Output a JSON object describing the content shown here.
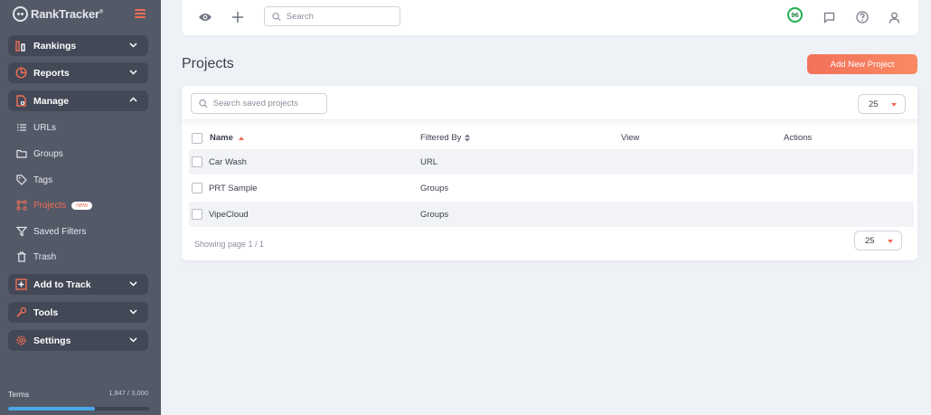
{
  "app": {
    "logo_text": "RankTracker"
  },
  "sidebar": {
    "sections": [
      {
        "label": "Rankings",
        "icon": "rankings-icon",
        "expanded": false
      },
      {
        "label": "Reports",
        "icon": "pie-chart-icon",
        "expanded": false
      },
      {
        "label": "Manage",
        "icon": "file-icon",
        "expanded": true
      },
      {
        "label": "Add to Track",
        "icon": "plus-box-icon",
        "expanded": false
      },
      {
        "label": "Tools",
        "icon": "wrench-icon",
        "expanded": false
      },
      {
        "label": "Settings",
        "icon": "gear-icon",
        "expanded": false
      }
    ],
    "manage_items": [
      {
        "label": "URLs",
        "icon": "list-icon",
        "active": false
      },
      {
        "label": "Groups",
        "icon": "folder-icon",
        "active": false
      },
      {
        "label": "Tags",
        "icon": "tag-icon",
        "active": false
      },
      {
        "label": "Projects",
        "icon": "projects-icon",
        "active": true,
        "badge": "new"
      },
      {
        "label": "Saved Filters",
        "icon": "filter-icon",
        "active": false
      },
      {
        "label": "Trash",
        "icon": "trash-icon",
        "active": false
      }
    ],
    "terms": {
      "label": "Terms",
      "count": "1,847 / 3,000",
      "fraction": 0.6157
    }
  },
  "topbar": {
    "search_placeholder": "Search",
    "score": "96",
    "icons": [
      "eye-icon",
      "plus-icon",
      "search-icon",
      "score-icon",
      "message-icon",
      "help-icon",
      "user-icon"
    ]
  },
  "page": {
    "title": "Projects",
    "add_button": "Add New Project"
  },
  "table": {
    "search_placeholder": "Search saved projects",
    "per_page": "25",
    "columns": [
      {
        "label": "Name",
        "sort": "asc"
      },
      {
        "label": "Filtered By",
        "sort": "both"
      },
      {
        "label": "View"
      },
      {
        "label": "Actions"
      }
    ],
    "rows": [
      {
        "name": "Car Wash",
        "filtered_by": "URL",
        "view": "",
        "actions": ""
      },
      {
        "name": "PRT Sample",
        "filtered_by": "Groups",
        "view": "",
        "actions": ""
      },
      {
        "name": "VipeCloud",
        "filtered_by": "Groups",
        "view": "",
        "actions": ""
      }
    ],
    "footer_text": "Showing page 1 / 1",
    "footer_per_page": "25"
  },
  "colors": {
    "accent": "#f06d53",
    "sidebar_bg": "#545968",
    "score_green": "#1fae4f",
    "progress_blue": "#4aa8e8"
  }
}
